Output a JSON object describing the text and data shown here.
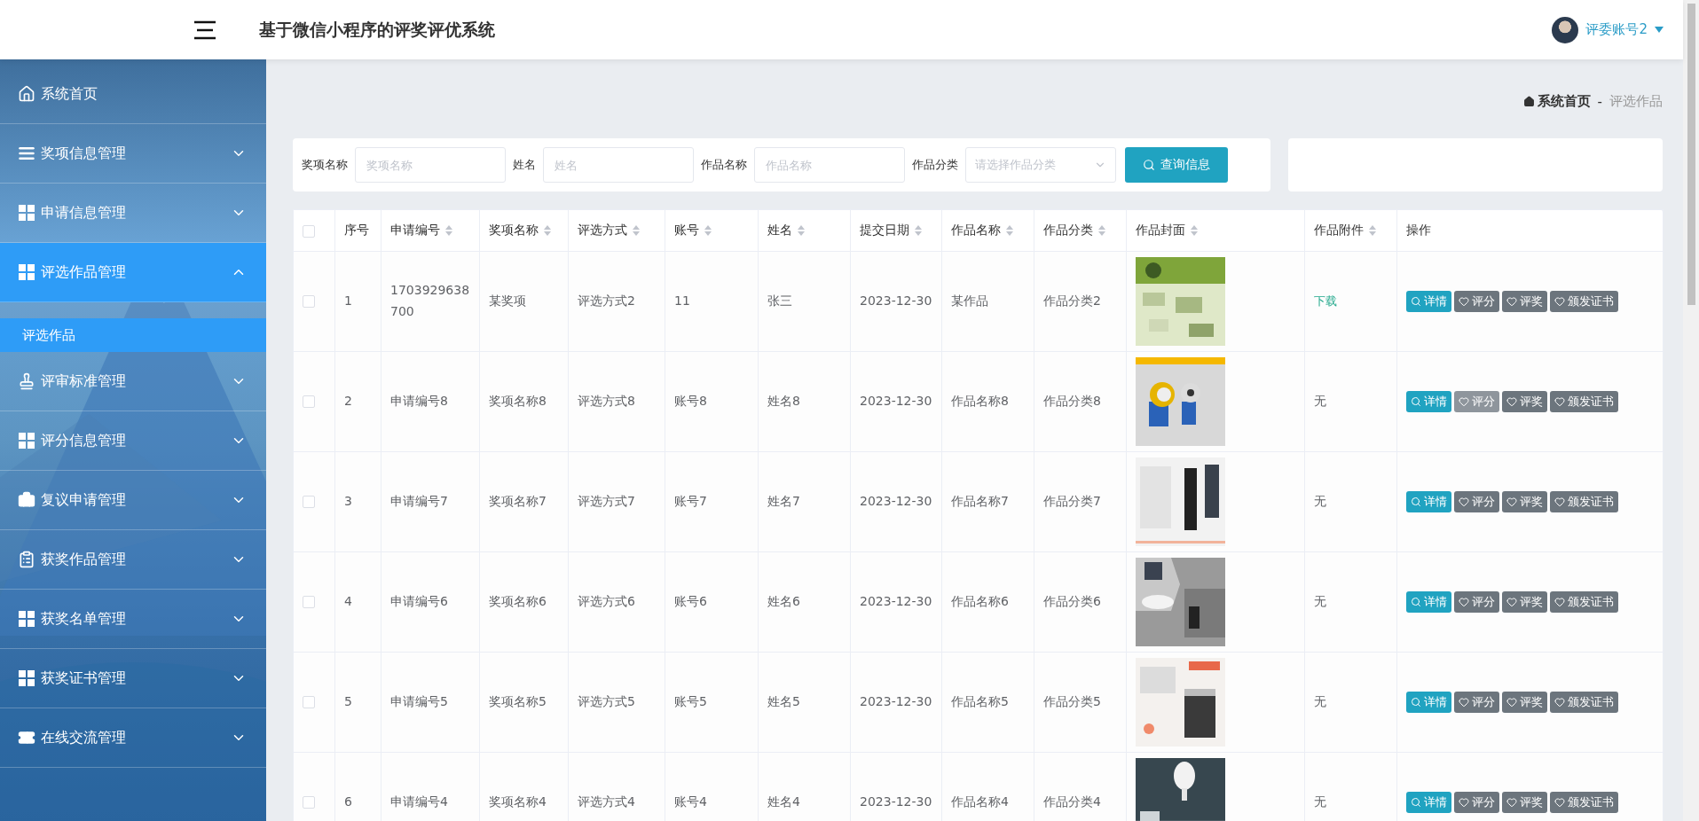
{
  "header": {
    "title": "基于微信小程序的评奖评优系统",
    "user": "评委账号2"
  },
  "sidebar": {
    "items": [
      {
        "label": "系统首页",
        "kind": "link",
        "selected": false
      },
      {
        "label": "奖项信息管理",
        "kind": "menu",
        "selected": false,
        "expanded": false
      },
      {
        "label": "申请信息管理",
        "kind": "menu",
        "selected": false,
        "expanded": false
      },
      {
        "label": "评选作品管理",
        "kind": "menu",
        "selected": true,
        "expanded": true,
        "children": [
          {
            "label": "评选作品",
            "selected": true
          }
        ]
      },
      {
        "label": "评审标准管理",
        "kind": "menu",
        "selected": false,
        "expanded": false
      },
      {
        "label": "评分信息管理",
        "kind": "menu",
        "selected": false,
        "expanded": false
      },
      {
        "label": "复议申请管理",
        "kind": "menu",
        "selected": false,
        "expanded": false
      },
      {
        "label": "获奖作品管理",
        "kind": "menu",
        "selected": false,
        "expanded": false
      },
      {
        "label": "获奖名单管理",
        "kind": "menu",
        "selected": false,
        "expanded": false
      },
      {
        "label": "获奖证书管理",
        "kind": "menu",
        "selected": false,
        "expanded": false
      },
      {
        "label": "在线交流管理",
        "kind": "menu",
        "selected": false,
        "expanded": false
      }
    ]
  },
  "breadcrumb": {
    "home": "系统首页",
    "separator": "-",
    "current": "评选作品"
  },
  "filters": [
    {
      "label": "奖项名称",
      "placeholder": "奖项名称",
      "kind": "input"
    },
    {
      "label": "姓名",
      "placeholder": "姓名",
      "kind": "input"
    },
    {
      "label": "作品名称",
      "placeholder": "作品名称",
      "kind": "input"
    },
    {
      "label": "作品分类",
      "placeholder": "请选择作品分类",
      "kind": "select"
    }
  ],
  "search_button": "查询信息",
  "table": {
    "select_all": {
      "checked": false
    },
    "columns": [
      {
        "label": "序号",
        "sortable": false
      },
      {
        "label": "申请编号",
        "sortable": true
      },
      {
        "label": "奖项名称",
        "sortable": true
      },
      {
        "label": "评选方式",
        "sortable": true
      },
      {
        "label": "账号",
        "sortable": true
      },
      {
        "label": "姓名",
        "sortable": true
      },
      {
        "label": "提交日期",
        "sortable": true
      },
      {
        "label": "作品名称",
        "sortable": true
      },
      {
        "label": "作品分类",
        "sortable": true
      },
      {
        "label": "作品封面",
        "sortable": true
      },
      {
        "label": "作品附件",
        "sortable": true
      },
      {
        "label": "操作",
        "sortable": false
      }
    ],
    "rows": [
      {
        "checked": false,
        "cells": [
          "1",
          "1703929638700",
          "某奖项",
          "评选方式2",
          "11",
          "张三",
          "2023-12-30",
          "某作品",
          "作品分类2"
        ],
        "attachment": {
          "text": "下载",
          "kind": "link"
        },
        "actions": [
          {
            "label": "详情",
            "kind": "detail",
            "hovered": false
          },
          {
            "label": "评分",
            "kind": "heart",
            "hovered": false
          },
          {
            "label": "评奖",
            "kind": "heart",
            "hovered": false
          },
          {
            "label": "颁发证书",
            "kind": "heart",
            "hovered": false
          }
        ]
      },
      {
        "checked": false,
        "cells": [
          "2",
          "申请编号8",
          "奖项名称8",
          "评选方式8",
          "账号8",
          "姓名8",
          "2023-12-30",
          "作品名称8",
          "作品分类8"
        ],
        "attachment": {
          "text": "无",
          "kind": "text"
        },
        "actions": [
          {
            "label": "详情",
            "kind": "detail",
            "hovered": false
          },
          {
            "label": "评分",
            "kind": "heart",
            "hovered": true
          },
          {
            "label": "评奖",
            "kind": "heart",
            "hovered": false
          },
          {
            "label": "颁发证书",
            "kind": "heart",
            "hovered": false
          }
        ]
      },
      {
        "checked": false,
        "cells": [
          "3",
          "申请编号7",
          "奖项名称7",
          "评选方式7",
          "账号7",
          "姓名7",
          "2023-12-30",
          "作品名称7",
          "作品分类7"
        ],
        "attachment": {
          "text": "无",
          "kind": "text"
        },
        "actions": [
          {
            "label": "详情",
            "kind": "detail",
            "hovered": false
          },
          {
            "label": "评分",
            "kind": "heart",
            "hovered": false
          },
          {
            "label": "评奖",
            "kind": "heart",
            "hovered": false
          },
          {
            "label": "颁发证书",
            "kind": "heart",
            "hovered": false
          }
        ]
      },
      {
        "checked": false,
        "cells": [
          "4",
          "申请编号6",
          "奖项名称6",
          "评选方式6",
          "账号6",
          "姓名6",
          "2023-12-30",
          "作品名称6",
          "作品分类6"
        ],
        "attachment": {
          "text": "无",
          "kind": "text"
        },
        "actions": [
          {
            "label": "详情",
            "kind": "detail",
            "hovered": false
          },
          {
            "label": "评分",
            "kind": "heart",
            "hovered": false
          },
          {
            "label": "评奖",
            "kind": "heart",
            "hovered": false
          },
          {
            "label": "颁发证书",
            "kind": "heart",
            "hovered": false
          }
        ]
      },
      {
        "checked": false,
        "cells": [
          "5",
          "申请编号5",
          "奖项名称5",
          "评选方式5",
          "账号5",
          "姓名5",
          "2023-12-30",
          "作品名称5",
          "作品分类5"
        ],
        "attachment": {
          "text": "无",
          "kind": "text"
        },
        "actions": [
          {
            "label": "详情",
            "kind": "detail",
            "hovered": false
          },
          {
            "label": "评分",
            "kind": "heart",
            "hovered": false
          },
          {
            "label": "评奖",
            "kind": "heart",
            "hovered": false
          },
          {
            "label": "颁发证书",
            "kind": "heart",
            "hovered": false
          }
        ]
      },
      {
        "checked": false,
        "cells": [
          "6",
          "申请编号4",
          "奖项名称4",
          "评选方式4",
          "账号4",
          "姓名4",
          "2023-12-30",
          "作品名称4",
          "作品分类4"
        ],
        "attachment": {
          "text": "无",
          "kind": "text"
        },
        "actions": [
          {
            "label": "详情",
            "kind": "detail",
            "hovered": false
          },
          {
            "label": "评分",
            "kind": "heart",
            "hovered": false
          },
          {
            "label": "评奖",
            "kind": "heart",
            "hovered": false
          },
          {
            "label": "颁发证书",
            "kind": "heart",
            "hovered": false
          }
        ]
      }
    ]
  }
}
